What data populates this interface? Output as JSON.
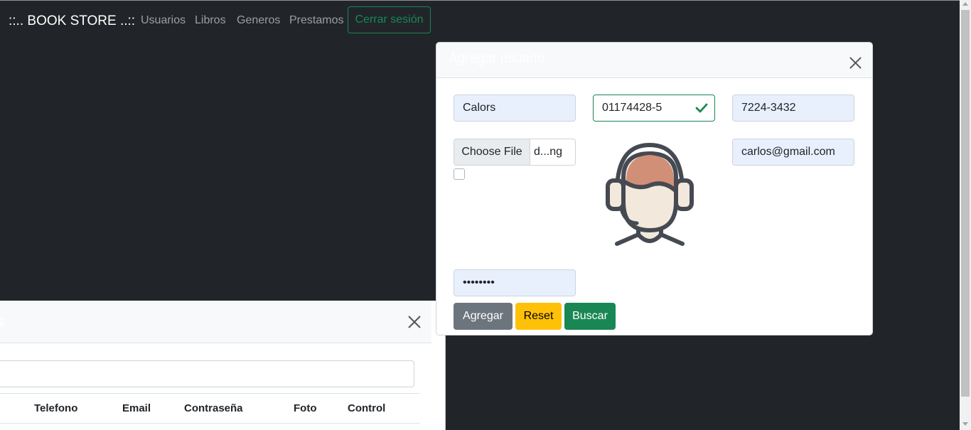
{
  "navbar": {
    "brand": "::.. BOOK STORE ..::",
    "links": [
      "Usuarios",
      "Libros",
      "Generos",
      "Prestamos"
    ],
    "logout_label": "Cerrar sesión"
  },
  "back_modal": {
    "title": "s",
    "columns": [
      "Telefono",
      "Email",
      "Contraseña",
      "Foto",
      "Control"
    ]
  },
  "modal": {
    "title": "Agregar usuario",
    "name_value": "Calors",
    "id_value": "01174428-5",
    "phone_value": "7224-3432",
    "file_button_label": "Choose File",
    "file_name": "d...ng",
    "email_value": "carlos@gmail.com",
    "password_value": "••••••••",
    "buttons": {
      "add": "Agregar",
      "reset": "Reset",
      "search": "Buscar"
    }
  },
  "colors": {
    "background": "#212529",
    "success": "#198754",
    "warning": "#ffc107",
    "secondary": "#6c757d",
    "autofill": "#e8f0fe"
  },
  "icons": {
    "close": "close-icon",
    "valid": "check-icon",
    "avatar": "user-headset-avatar"
  }
}
